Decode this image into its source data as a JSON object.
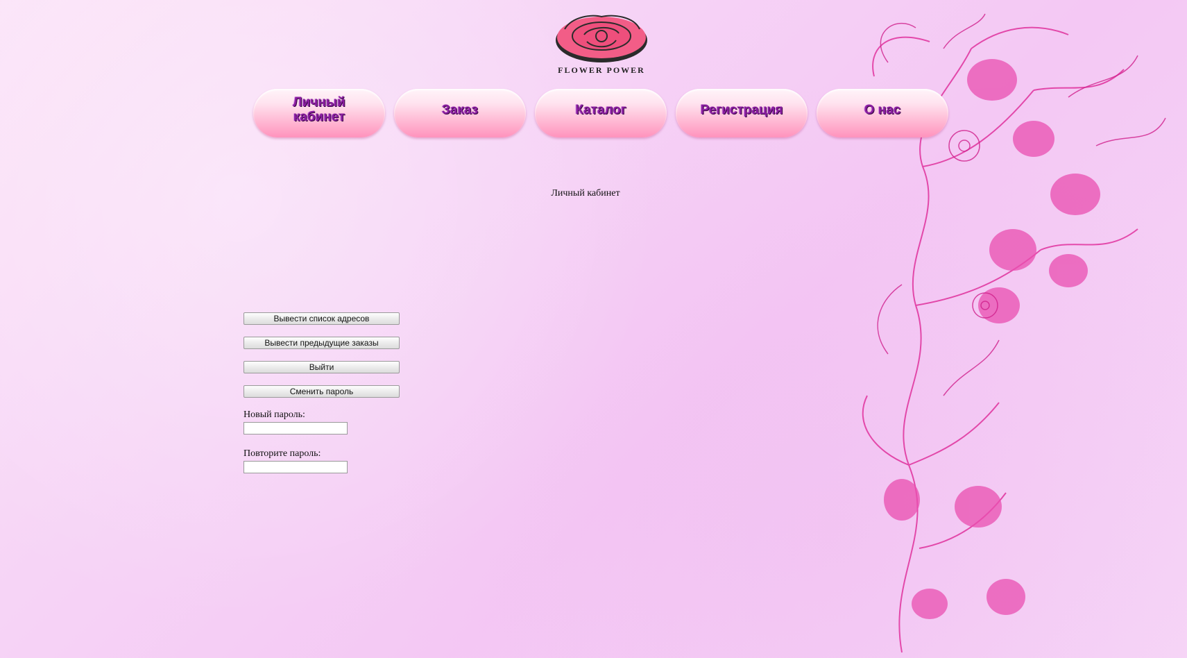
{
  "logo": {
    "brand_text": "FLOWER POWER",
    "icon": "rose-logo-icon"
  },
  "nav": {
    "items": [
      {
        "label": "Личный кабинет"
      },
      {
        "label": "Заказ"
      },
      {
        "label": "Каталог"
      },
      {
        "label": "Регистрация"
      },
      {
        "label": "О нас"
      }
    ]
  },
  "page": {
    "heading": "Личный кабинет"
  },
  "actions": {
    "show_addresses": "Вывести список адресов",
    "show_orders": "Вывести предыдущие заказы",
    "logout": "Выйти",
    "change_password": "Сменить пароль"
  },
  "password_form": {
    "new_password_label": "Новый пароль:",
    "new_password_value": "",
    "repeat_password_label": "Повторите пароль:",
    "repeat_password_value": ""
  },
  "colors": {
    "background": "#f6d3f6",
    "nav_text": "#8a1ea0",
    "floral": "#e0329d"
  },
  "decoration": {
    "icon": "floral-ornament-icon"
  }
}
